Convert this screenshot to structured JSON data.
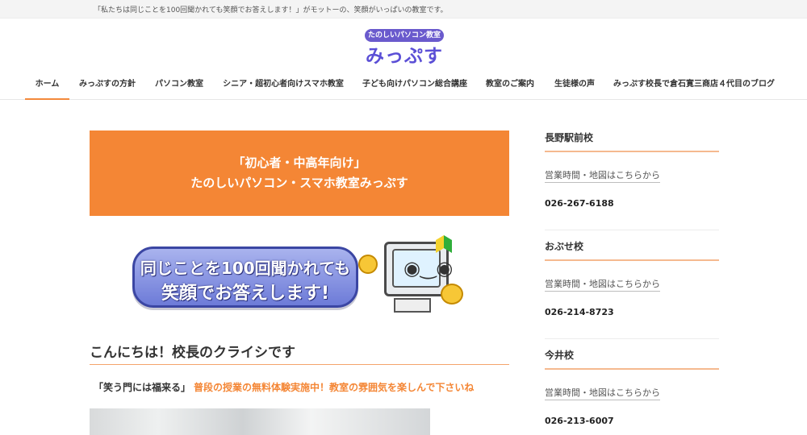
{
  "topbar": {
    "tagline": "「私たちは同じことを100回聞かれても笑顔でお答えします！」がモットーの、笑顔がいっぱいの教室です。"
  },
  "logo": {
    "subtitle": "たのしいパソコン教室",
    "name": "みっぷす"
  },
  "nav": {
    "items": [
      {
        "label": "ホーム"
      },
      {
        "label": "みっぷすの方針"
      },
      {
        "label": "パソコン教室"
      },
      {
        "label": "シニア・超初心者向けスマホ教室"
      },
      {
        "label": "子ども向けパソコン総合講座"
      },
      {
        "label": "教室のご案内"
      },
      {
        "label": "生徒様の声"
      },
      {
        "label": "みっぷす校長で倉石寛三商店４代目のブログ"
      }
    ]
  },
  "banner": {
    "line1": "「初心者・中高年向け」",
    "line2": "たのしいパソコン・スマホ教室みっぷす"
  },
  "hero": {
    "line1": "同じことを100回聞かれても",
    "line2": "笑顔でお答えします!"
  },
  "main": {
    "heading": "こんにちは！校長のクライシです",
    "quote": "「笑う門には福来る」",
    "highlight": "普段の授業の無料体験実施中！教室の雰囲気を楽しんで下さいね"
  },
  "sidebar": {
    "schools": [
      {
        "name": "長野駅前校",
        "link": "営業時間・地図はこちらから",
        "phone": "026-267-6188"
      },
      {
        "name": "おぶせ校",
        "link": "営業時間・地図はこちらから",
        "phone": "026-214-8723"
      },
      {
        "name": "今井校",
        "link": "営業時間・地図はこちらから",
        "phone": "026-213-6007"
      }
    ]
  },
  "colors": {
    "accent": "#f48635",
    "brand": "#5b4fd6"
  }
}
